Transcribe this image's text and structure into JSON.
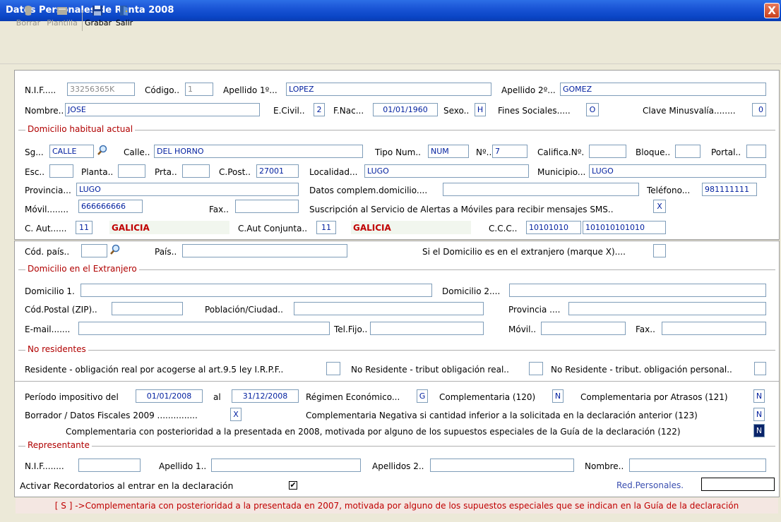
{
  "window": {
    "title": "Datos Personales de Renta 2008",
    "close": "X"
  },
  "toolbar": {
    "borrar": "Borrar",
    "plantilla": "Plantilla",
    "grabar": "Grabar",
    "salir": "Salir"
  },
  "personal": {
    "nif_label": "N.I.F.....",
    "nif": "33256365K",
    "codigo_label": "Código..",
    "codigo": "1",
    "ap1_label": "Apellido 1º...",
    "ap1": "LOPEZ",
    "ap2_label": "Apellido 2º...",
    "ap2": "GOMEZ",
    "nombre_label": "Nombre..",
    "nombre": "JOSE",
    "ecivil_label": "E.Civil..",
    "ecivil": "2",
    "fnac_label": "F.Nac...",
    "fnac": "01/01/1960",
    "sexo_label": "Sexo..",
    "sexo": "H",
    "fines_label": "Fines Sociales.....",
    "fines": "O",
    "minus_label": "Clave Minusvalía........",
    "minus": "0"
  },
  "domicilio": {
    "section": "Domicilio habitual actual",
    "sg_label": "Sg...",
    "sg": "CALLE",
    "calle_label": "Calle..",
    "calle": "DEL HORNO",
    "tiponum_label": "Tipo Num..",
    "tiponum": "NUM",
    "num_label": "Nº..",
    "num": "7",
    "califica_label": "Califica.Nº.",
    "califica": "",
    "bloque_label": "Bloque..",
    "bloque": "",
    "portal_label": "Portal..",
    "portal": "",
    "esc_label": "Esc..",
    "esc": "",
    "planta_label": "Planta..",
    "planta": "",
    "prta_label": "Prta..",
    "prta": "",
    "cpost_label": "C.Post..",
    "cpost": "27001",
    "localidad_label": "Localidad...",
    "localidad": "LUGO",
    "municipio_label": "Municipio...",
    "municipio": "LUGO",
    "provincia_label": "Provincia...",
    "provincia": "LUGO",
    "datoscomp_label": "Datos complem.domicilio....",
    "datoscomp": "",
    "telefono_label": "Teléfono...",
    "telefono": "981111111",
    "movil_label": "Móvil........",
    "movil": "666666666",
    "fax_label": "Fax..",
    "fax": "",
    "sms_label": "Suscripción al Servicio de Alertas a Móviles para recibir mensajes SMS..",
    "sms": "X",
    "caut_label": "C. Aut......",
    "caut": "11",
    "caut_name": "GALICIA",
    "cautconj_label": "C.Aut Conjunta..",
    "cautconj": "11",
    "cautconj_name": "GALICIA",
    "ccc_label": "C.C.C..",
    "ccc1": "10101010",
    "ccc2": "101010101010"
  },
  "extranjero": {
    "codpais_label": "Cód. país..",
    "codpais": "",
    "pais_label": "País..",
    "pais": "",
    "siext_label": "Si el Domicilio es en el extranjero (marque X)....",
    "siext": "",
    "section": "Domicilio en el Extranjero",
    "dom1_label": "Domicilio 1.",
    "dom1": "",
    "dom2_label": "Domicilio 2....",
    "dom2": "",
    "zip_label": "Cód.Postal (ZIP)..",
    "zip": "",
    "poblacion_label": "Población/Ciudad..",
    "poblacion": "",
    "provincia_label": "Provincia ....",
    "provincia": "",
    "email_label": "E-mail.......",
    "email": "",
    "telfijo_label": "Tel.Fijo..",
    "telfijo": "",
    "movil_label": "Móvil..",
    "movil": "",
    "fax_label": "Fax..",
    "fax": ""
  },
  "noresidentes": {
    "section": "No residentes",
    "r1_label": "Residente - obligación real por acogerse al art.9.5  ley I.R.P.F..",
    "r1": "",
    "r2_label": "No Residente - tribut obligación real..",
    "r2": "",
    "r3_label": "No Residente - tribut. obligación personal..",
    "r3": ""
  },
  "periodo": {
    "label": "Período impositivo del",
    "desde": "01/01/2008",
    "al_label": "al",
    "hasta": "31/12/2008",
    "regimen_label": "Régimen Económico...",
    "regimen": "G",
    "comp120_label": "Complementaria (120)",
    "comp120": "N",
    "comp121_label": "Complementaria por Atrasos (121)",
    "comp121": "N",
    "borrador_label": "Borrador / Datos Fiscales 2009 ...............",
    "borrador": "X",
    "comp123_label": "Complementaria Negativa si cantidad inferior a la solicitada en la declaración anterior  (123)",
    "comp123": "N",
    "comp122_label": "Complementaria con posterioridad a la presentada en 2008, motivada por alguno de los supuestos especiales de la Guía de la declaración  (122)",
    "comp122": "N"
  },
  "representante": {
    "section": "Representante",
    "nif_label": "N.I.F........",
    "nif": "",
    "ap1_label": "Apellido 1..",
    "ap1": "",
    "ap2_label": "Apellidos 2..",
    "ap2": "",
    "nombre_label": "Nombre..",
    "nombre": ""
  },
  "footer": {
    "recordatorio_label": "Activar Recordatorios al entrar en la declaración",
    "recordatorio": "✔",
    "redpers_label": "Red.Personales.",
    "redpers": "",
    "note": "[ S ] ->Complementaria con posterioridad a la presentada en 2007, motivada por alguno de los supuestos especiales que se indican en la Guía de la declaración"
  }
}
